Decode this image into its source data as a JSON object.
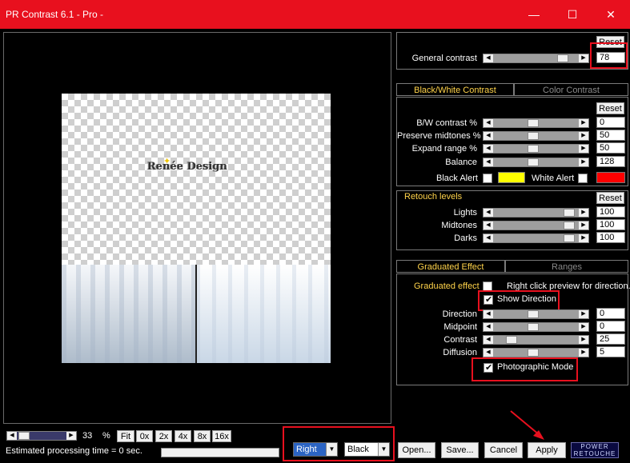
{
  "window": {
    "title": "PR Contrast 6.1 - Pro -",
    "minimize": "—",
    "maximize": "☐",
    "close": "✕"
  },
  "preview": {
    "logo_text": "Renée Design"
  },
  "general": {
    "reset": "Reset",
    "label": "General contrast",
    "value": "78"
  },
  "tabs1": {
    "bw": "Black/White Contrast",
    "color": "Color Contrast"
  },
  "bw": {
    "reset": "Reset",
    "rows": [
      {
        "label": "B/W contrast %",
        "value": "0"
      },
      {
        "label": "Preserve midtones %",
        "value": "50"
      },
      {
        "label": "Expand range %",
        "value": "50"
      },
      {
        "label": "Balance",
        "value": "128"
      }
    ],
    "black_alert": "Black Alert",
    "white_alert": "White Alert",
    "black_alert_color": "#ffff00",
    "white_alert_color": "#ff0000"
  },
  "retouch": {
    "title": "Retouch levels",
    "reset": "Reset",
    "rows": [
      {
        "label": "Lights",
        "value": "100"
      },
      {
        "label": "Midtones",
        "value": "100"
      },
      {
        "label": "Darks",
        "value": "100"
      }
    ]
  },
  "tabs2": {
    "graduated": "Graduated Effect",
    "ranges": "Ranges"
  },
  "graduated": {
    "enable_label": "Graduated effect",
    "hint": "Right click preview for direction.",
    "show_direction": "Show Direction",
    "rows": [
      {
        "label": "Direction",
        "value": "0"
      },
      {
        "label": "Midpoint",
        "value": "0"
      },
      {
        "label": "Contrast",
        "value": "25"
      },
      {
        "label": "Diffusion",
        "value": "5"
      }
    ],
    "photographic_mode": "Photographic Mode"
  },
  "zoom": {
    "value": "33",
    "unit": "%",
    "buttons": [
      "Fit",
      "0x",
      "2x",
      "4x",
      "8x",
      "16x"
    ]
  },
  "status": {
    "text": "Estimated processing time =  0 sec."
  },
  "combos": {
    "position": "Right",
    "background": "Black"
  },
  "actions": {
    "open": "Open...",
    "save": "Save...",
    "cancel": "Cancel",
    "apply": "Apply"
  },
  "brand": {
    "line1": "POWER",
    "line2": "RETOUCHE"
  }
}
